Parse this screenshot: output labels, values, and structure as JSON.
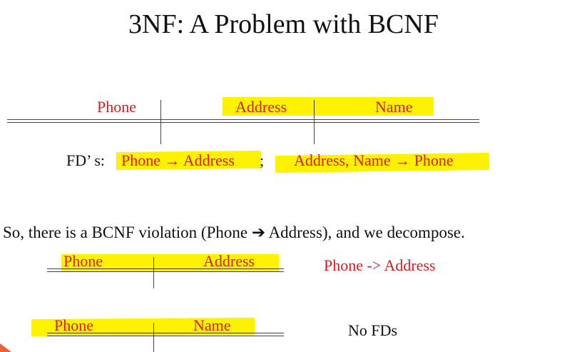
{
  "slide": {
    "title": "3NF: A Problem with BCNF",
    "table1": {
      "col1": "Phone",
      "col2": "Address",
      "col3": "Name"
    },
    "fds": {
      "label": "FD’ s:",
      "fd1": "Phone → Address",
      "sep": ";",
      "fd2": "Address, Name → Phone"
    },
    "statement": "So, there is a BCNF violation (Phone ➔ Address), and we decompose.",
    "table2": {
      "col1": "Phone",
      "col2": "Address",
      "fd": "Phone -> Address"
    },
    "table3": {
      "col1": "Phone",
      "col2": "Name",
      "fd": "No  FDs"
    }
  },
  "colors": {
    "highlight": "#fff200",
    "accent_text": "#d81d1d",
    "body_text": "#111111"
  }
}
